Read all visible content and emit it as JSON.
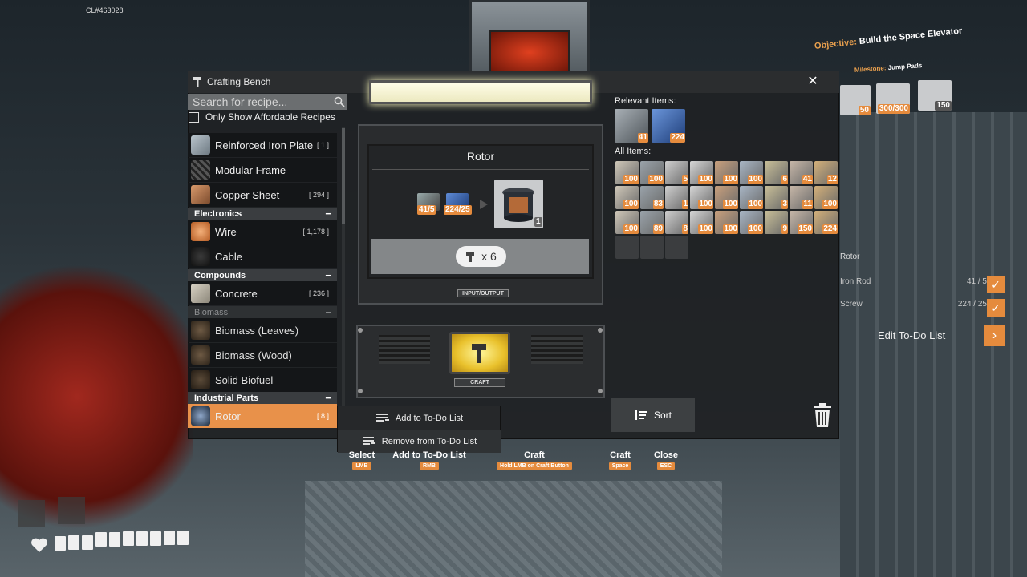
{
  "build_label": "CL#463028",
  "window": {
    "title": "Crafting Bench",
    "close_label": "✕",
    "search_placeholder": "Search for recipe...",
    "filter_label": "Only Show Affordable Recipes"
  },
  "recipes": {
    "reinforced_iron_plate": {
      "label": "Reinforced Iron Plate",
      "count": "[ 1 ]"
    },
    "modular_frame": {
      "label": "Modular Frame",
      "count": ""
    },
    "copper_sheet": {
      "label": "Copper Sheet",
      "count": "[ 294 ]"
    },
    "wire": {
      "label": "Wire",
      "count": "[ 1,178 ]"
    },
    "cable": {
      "label": "Cable",
      "count": ""
    },
    "concrete": {
      "label": "Concrete",
      "count": "[ 236 ]"
    },
    "biomass_leaves": {
      "label": "Biomass (Leaves)",
      "count": ""
    },
    "biomass_wood": {
      "label": "Biomass (Wood)",
      "count": ""
    },
    "solid_biofuel": {
      "label": "Solid Biofuel",
      "count": ""
    },
    "rotor": {
      "label": "Rotor",
      "count": "[ 8 ]"
    }
  },
  "categories": {
    "electronics": {
      "label": "Electronics",
      "toggle": "−"
    },
    "compounds": {
      "label": "Compounds",
      "toggle": "−"
    },
    "biomass": {
      "label": "Biomass",
      "toggle": "−"
    },
    "industrial_parts": {
      "label": "Industrial Parts",
      "toggle": "−"
    }
  },
  "machine": {
    "recipe_title": "Rotor",
    "ingredient_1": "41/5",
    "ingredient_2": "224/25",
    "output_count": "1",
    "craft_multiplier": "x 6",
    "io_label": "INPUT/OUTPUT",
    "craft_label": "CRAFT"
  },
  "inventory": {
    "relevant_label": "Relevant Items:",
    "relevant": [
      "41",
      "224"
    ],
    "all_label": "All Items:",
    "all": [
      "100",
      "100",
      "5",
      "100",
      "100",
      "100",
      "6",
      "41",
      "12",
      "100",
      "83",
      "1",
      "100",
      "100",
      "100",
      "3",
      "11",
      "100",
      "100",
      "89",
      "8",
      "100",
      "100",
      "100",
      "9",
      "150",
      "224"
    ],
    "sort_label": "Sort"
  },
  "context_menu": {
    "add": "Add to To-Do List",
    "remove": "Remove from To-Do List"
  },
  "hints": [
    {
      "action": "Select",
      "key": "LMB"
    },
    {
      "action": "Add to To-Do List",
      "key": "RMB"
    },
    {
      "action": "Craft",
      "key": "Hold LMB on Craft Button"
    },
    {
      "action": "Craft",
      "key": "Space"
    },
    {
      "action": "Close",
      "key": "ESC"
    }
  ],
  "hud": {
    "objective_prefix": "Objective:",
    "objective_text": "Build the Space Elevator",
    "milestone_prefix": "Milestone:",
    "milestone_text": "Jump Pads",
    "milestone_items": [
      "50",
      "300/300",
      "150"
    ],
    "todo_title": "Rotor",
    "todo_rows": [
      {
        "label": "Iron Rod",
        "amount": "41 / 5"
      },
      {
        "label": "Screw",
        "amount": "224 / 25"
      }
    ],
    "edit_todo": "Edit To-Do List",
    "health_segments": 10
  },
  "colors": {
    "accent": "#e58b3d",
    "selected_row": "#e8914a"
  }
}
